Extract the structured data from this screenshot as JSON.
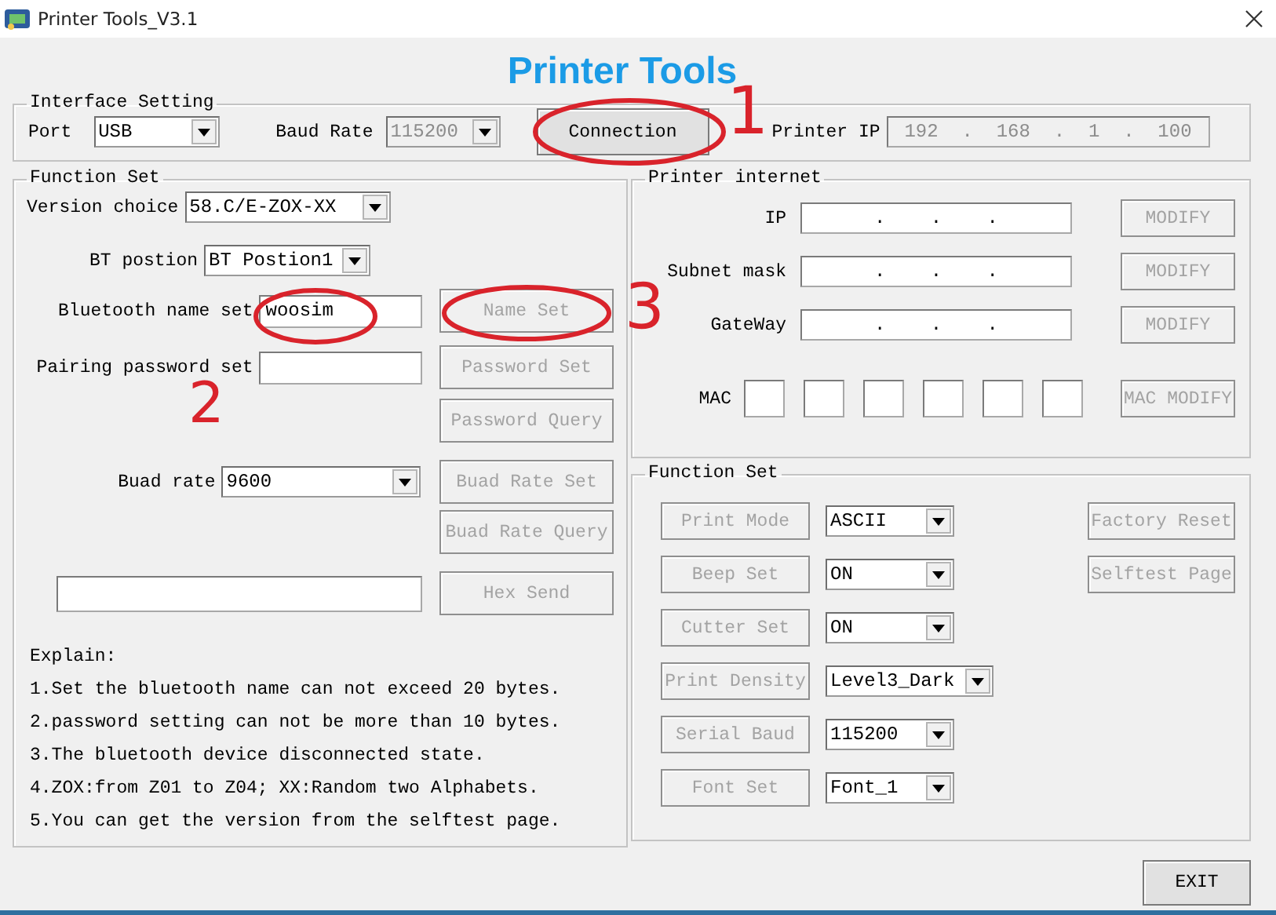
{
  "window": {
    "title": "Printer Tools_V3.1"
  },
  "heading": "Printer Tools",
  "interface_setting": {
    "title": "Interface Setting",
    "port": {
      "label": "Port",
      "value": "USB",
      "disabled": false
    },
    "baud_rate": {
      "label": "Baud Rate",
      "value": "115200",
      "disabled": true
    },
    "connect_button": {
      "label": "Connection",
      "disabled": false
    },
    "printer_ip": {
      "label": "Printer IP",
      "octets": [
        "192",
        "168",
        "1",
        "100"
      ],
      "separators": [
        ".",
        ".",
        "."
      ],
      "disabled": true
    }
  },
  "bluetooth_set": {
    "title": "Function Set",
    "version": {
      "label": "Version choice",
      "value": "58.C/E-ZOX-XX"
    },
    "bt_position": {
      "label": "BT postion",
      "value": "BT Postion1"
    },
    "name": {
      "label": "Bluetooth name set",
      "value": "woosim",
      "button": {
        "label": "Name Set",
        "disabled": true
      }
    },
    "password": {
      "label": "Pairing password set",
      "button": {
        "label": "Password Set",
        "disabled": true
      }
    },
    "password_query": {
      "label": "Password Query",
      "disabled": true
    },
    "buad_rate": {
      "label": "Buad rate",
      "value": "9600",
      "button": {
        "label": "Buad Rate Set",
        "disabled": true
      }
    },
    "buad_rate_query": {
      "label": "Buad Rate Query",
      "disabled": true
    },
    "hex_send": {
      "label": "Hex Send",
      "disabled": true
    },
    "explain": {
      "title": "Explain:",
      "lines": [
        "1.Set the bluetooth name can not exceed 20 bytes.",
        "2.password setting can not be more than 10 bytes.",
        "3.The bluetooth device disconnected state.",
        "4.ZOX:from Z01 to Z04; XX:Random two Alphabets.",
        "5.You can get the version from the selftest page."
      ]
    }
  },
  "printer_internet": {
    "title": "Printer internet",
    "fields": [
      {
        "label": "IP",
        "separators": [
          ".",
          ".",
          "."
        ],
        "button": {
          "label": "MODIFY",
          "disabled": true
        }
      },
      {
        "label": "Subnet mask",
        "separators": [
          ".",
          ".",
          "."
        ],
        "button": {
          "label": "MODIFY",
          "disabled": true
        }
      },
      {
        "label": "GateWay",
        "separators": [
          ".",
          ".",
          "."
        ],
        "button": {
          "label": "MODIFY",
          "disabled": true
        }
      }
    ],
    "mac": {
      "label": "MAC",
      "button": {
        "label": "MAC MODIFY",
        "disabled": true
      }
    }
  },
  "printer_function_set": {
    "title": "Function Set",
    "rows": [
      {
        "button": {
          "label": "Print Mode",
          "disabled": true
        },
        "value": "ASCII"
      },
      {
        "button": {
          "label": "Beep Set",
          "disabled": true
        },
        "value": "ON"
      },
      {
        "button": {
          "label": "Cutter Set",
          "disabled": true
        },
        "value": "ON"
      },
      {
        "button": {
          "label": "Print Density",
          "disabled": true
        },
        "value": "Level3_Dark"
      },
      {
        "button": {
          "label": "Serial Baud",
          "disabled": true
        },
        "value": "115200"
      },
      {
        "button": {
          "label": "Font Set",
          "disabled": true
        },
        "value": "Font_1"
      }
    ],
    "side_buttons": [
      {
        "label": "Factory Reset",
        "disabled": true
      },
      {
        "label": "Selftest Page",
        "disabled": true
      }
    ]
  },
  "exit_button": {
    "label": "EXIT",
    "disabled": false
  },
  "annotations": [
    {
      "label": "1"
    },
    {
      "label": "2"
    },
    {
      "label": "3"
    }
  ]
}
